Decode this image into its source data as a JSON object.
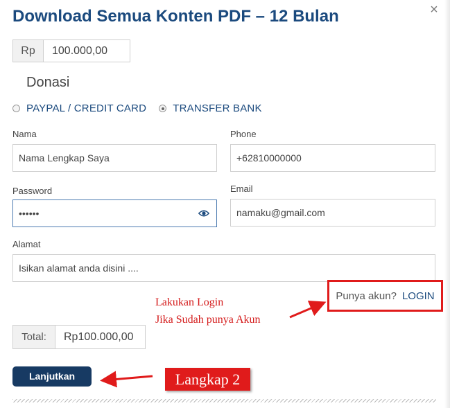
{
  "dialog": {
    "title": "Download Semua Konten PDF – 12 Bulan",
    "close_icon": "close-icon",
    "close_glyph": "×"
  },
  "amount": {
    "currency": "Rp",
    "value": "100.000,00"
  },
  "donation": {
    "heading": "Donasi"
  },
  "payment": {
    "options": [
      {
        "label": "PAYPAL / CREDIT CARD",
        "selected": false
      },
      {
        "label": "TRANSFER BANK",
        "selected": true
      }
    ]
  },
  "form": {
    "name": {
      "label": "Nama",
      "value": "Nama Lengkap Saya"
    },
    "phone": {
      "label": "Phone",
      "value": "+62810000000"
    },
    "password": {
      "label": "Password",
      "value": "••••••",
      "icon": "eye-icon"
    },
    "email": {
      "label": "Email",
      "value": "namaku@gmail.com"
    },
    "address": {
      "label": "Alamat",
      "value": "Isikan alamat anda disini ...."
    }
  },
  "login": {
    "question": "Punya akun?",
    "link": "LOGIN"
  },
  "annotations": {
    "login_line1": "Lakukan Login",
    "login_line2": "Jika Sudah punya Akun",
    "step": "Langkap 2",
    "color": "#e01b1b"
  },
  "total": {
    "label": "Total:",
    "value": "Rp100.000,00"
  },
  "actions": {
    "next_label": "Lanjutkan"
  },
  "colors": {
    "brand": "#1b4a7e",
    "button": "#173a63",
    "annotation": "#e01b1b"
  }
}
